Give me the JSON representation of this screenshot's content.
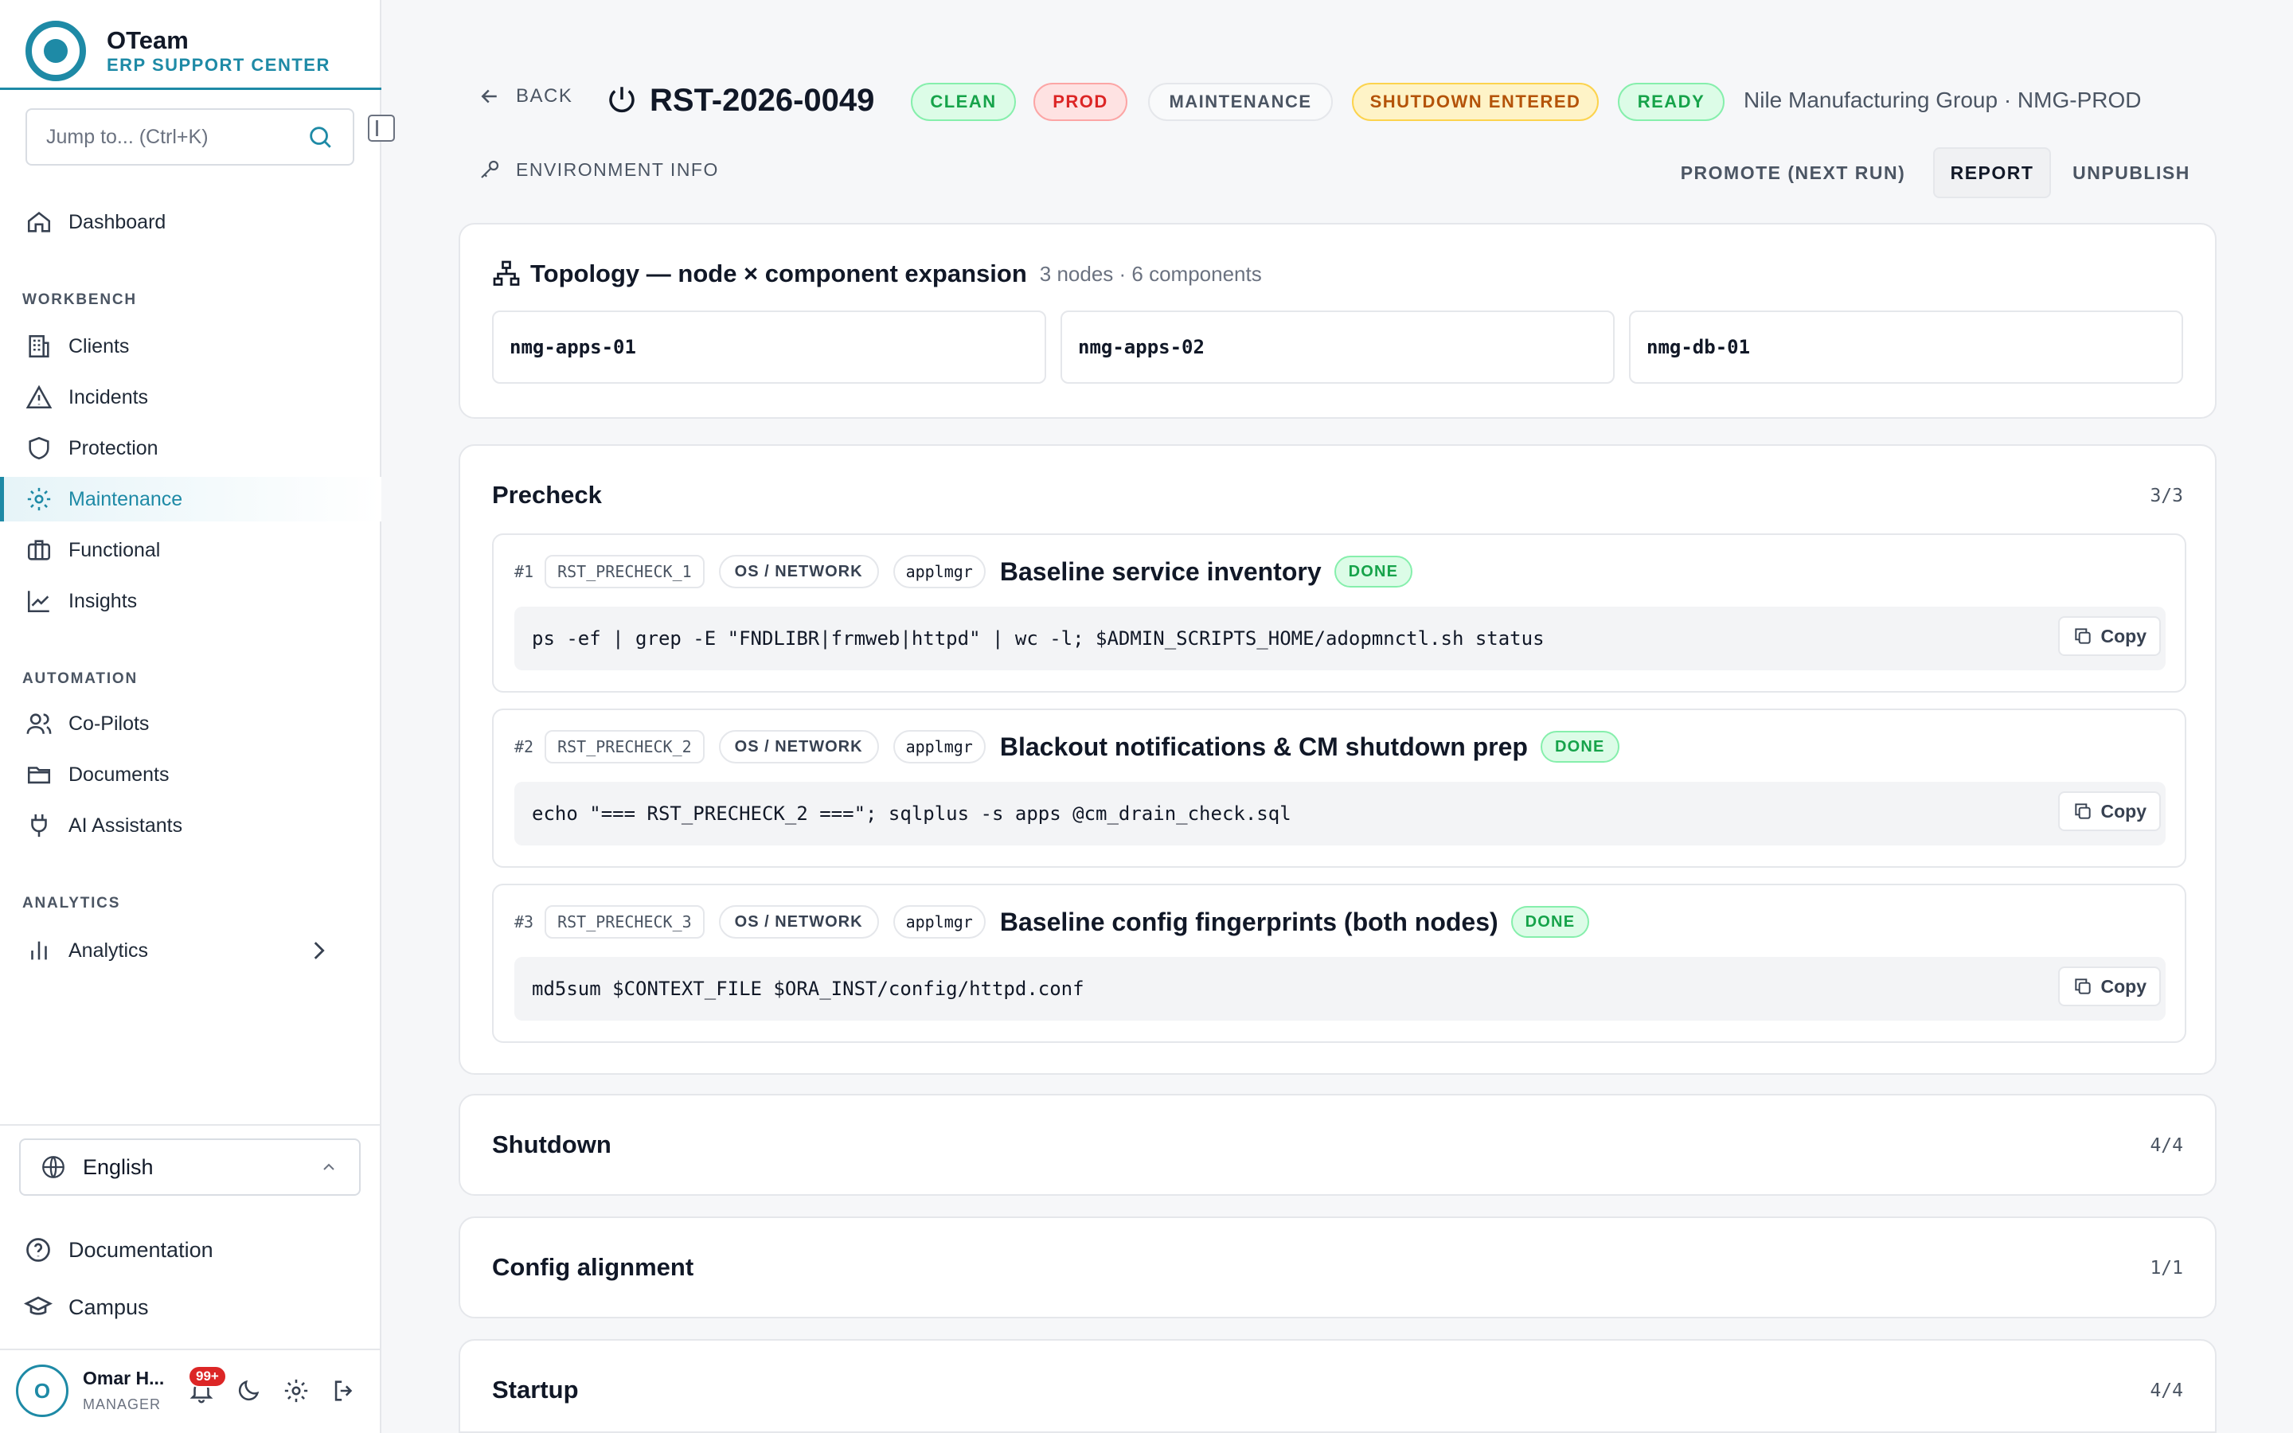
{
  "brand": {
    "name": "OTeam",
    "subtitle": "ERP SUPPORT CENTER"
  },
  "search": {
    "placeholder": "Jump to... (Ctrl+K)"
  },
  "nav": {
    "dashboard": "Dashboard",
    "sections": {
      "workbench": "WORKBENCH",
      "automation": "AUTOMATION",
      "analytics": "ANALYTICS"
    },
    "workbench_items": [
      "Clients",
      "Incidents",
      "Protection",
      "Maintenance",
      "Functional",
      "Insights"
    ],
    "automation_items": [
      "Co-Pilots",
      "Documents",
      "AI Assistants"
    ],
    "analytics_items": [
      "Analytics"
    ],
    "active": "Maintenance"
  },
  "language": {
    "selected": "English"
  },
  "bottom_links": [
    "Documentation",
    "Campus"
  ],
  "user": {
    "name": "Omar H...",
    "role": "MANAGER",
    "initial": "O",
    "notifications": "99+"
  },
  "header": {
    "back": "BACK",
    "run_id": "RST-2026-0049",
    "badges": [
      "CLEAN",
      "PROD",
      "MAINTENANCE",
      "SHUTDOWN ENTERED",
      "READY"
    ],
    "client": "Nile Manufacturing Group · NMG-PROD",
    "env_info": "ENVIRONMENT INFO",
    "actions": [
      "PROMOTE (NEXT RUN)",
      "REPORT",
      "UNPUBLISH"
    ]
  },
  "topology": {
    "title": "Topology — node × component expansion",
    "count": "3 nodes · 6 components",
    "nodes": [
      "nmg-apps-01",
      "nmg-apps-02",
      "nmg-db-01"
    ]
  },
  "precheck": {
    "title": "Precheck",
    "count": "3/3",
    "steps": [
      {
        "num": "#1",
        "code": "RST_PRECHECK_1",
        "category": "OS / NETWORK",
        "user": "applmgr",
        "title": "Baseline service inventory",
        "status": "DONE",
        "command": "ps -ef | grep -E \"FNDLIBR|frmweb|httpd\" | wc -l; $ADMIN_SCRIPTS_HOME/adopmnctl.sh status",
        "copy": "Copy"
      },
      {
        "num": "#2",
        "code": "RST_PRECHECK_2",
        "category": "OS / NETWORK",
        "user": "applmgr",
        "title": "Blackout notifications & CM shutdown prep",
        "status": "DONE",
        "command": "echo \"=== RST_PRECHECK_2 ===\"; sqlplus -s apps @cm_drain_check.sql",
        "copy": "Copy"
      },
      {
        "num": "#3",
        "code": "RST_PRECHECK_3",
        "category": "OS / NETWORK",
        "user": "applmgr",
        "title": "Baseline config fingerprints (both nodes)",
        "status": "DONE",
        "command": "md5sum $CONTEXT_FILE $ORA_INST/config/httpd.conf",
        "copy": "Copy"
      }
    ]
  },
  "sections": [
    {
      "title": "Shutdown",
      "count": "4/4"
    },
    {
      "title": "Config alignment",
      "count": "1/1"
    },
    {
      "title": "Startup",
      "count": "4/4"
    }
  ],
  "colors": {
    "accent": "#1e8aa6",
    "done_green": "#16a34a",
    "prod_red": "#dc2626",
    "warn_amber": "#b45309"
  }
}
